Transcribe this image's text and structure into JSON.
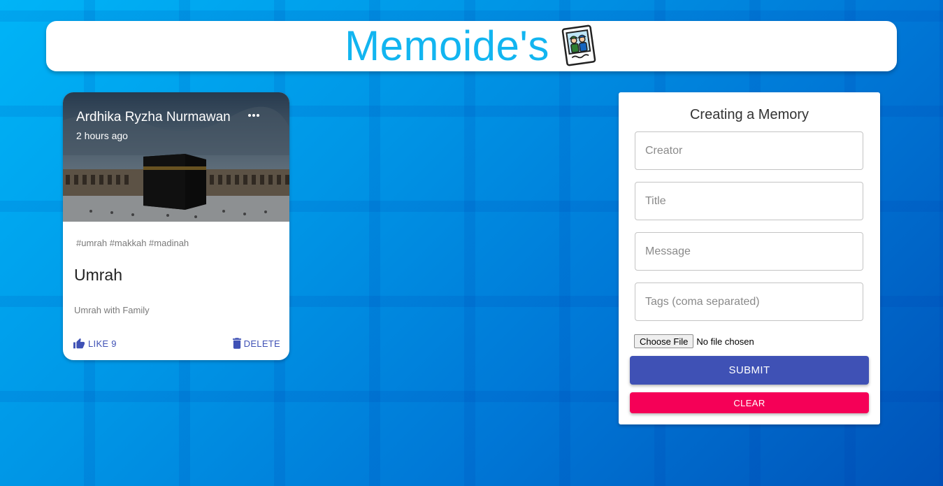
{
  "app": {
    "title": "Memoide's",
    "logo_icon": "memories-photo-icon",
    "brand_color": "#12b5f0"
  },
  "post": {
    "creator": "Ardhika Ryzha Nurmawan",
    "time": "2 hours ago",
    "more_icon": "more-horiz-icon",
    "image_icon": "kaaba-photo",
    "tags": "#umrah #makkah #madinah",
    "title": "Umrah",
    "message": "Umrah with Family",
    "like_label": "LIKE 9",
    "like_icon": "thumb-up-icon",
    "delete_label": "DELETE",
    "delete_icon": "trash-icon",
    "action_color": "#3f51b5"
  },
  "form": {
    "heading": "Creating a Memory",
    "fields": [
      {
        "placeholder": "Creator",
        "value": ""
      },
      {
        "placeholder": "Title",
        "value": ""
      },
      {
        "placeholder": "Message",
        "value": ""
      },
      {
        "placeholder": "Tags (coma separated)",
        "value": ""
      }
    ],
    "file_button": "Choose File",
    "file_status": "No file chosen",
    "submit_label": "SUBMIT",
    "submit_color": "#3f51b5",
    "clear_label": "CLEAR",
    "clear_color": "#f50057"
  }
}
